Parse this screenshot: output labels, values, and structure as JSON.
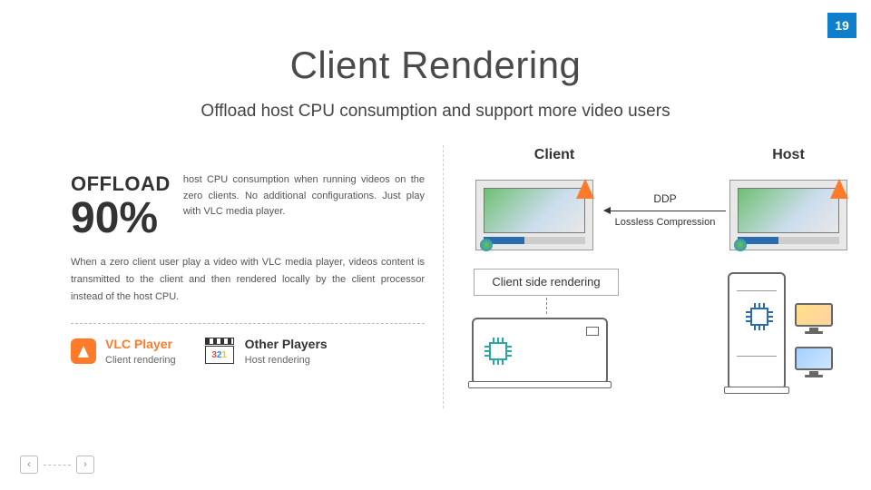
{
  "page_number": "19",
  "title": "Client Rendering",
  "subtitle": "Offload host CPU consumption and support more video users",
  "offload": {
    "label": "OFFLOAD",
    "percent": "90%",
    "desc": "host CPU consumption when running videos on the zero clients. No additional configurations. Just play with VLC media player."
  },
  "paragraph": "When a zero client user play a video with VLC media player, videos content is transmitted to the client and then rendered locally by the client processor instead of the host CPU.",
  "players": {
    "vlc": {
      "title": "VLC Player",
      "sub": "Client rendering"
    },
    "other": {
      "title": "Other Players",
      "sub": "Host rendering",
      "badge": "321"
    }
  },
  "columns": {
    "client": "Client",
    "host": "Host"
  },
  "arrow": {
    "top": "DDP",
    "bottom": "Lossless Compression"
  },
  "csr_label": "Client side rendering",
  "icons": {
    "vlc": "vlc-cone-icon",
    "mpc": "media-player-classic-icon",
    "chip": "cpu-chip-icon",
    "monitor": "monitor-icon"
  },
  "colors": {
    "accent": "#0f7fcc",
    "vlc": "#ff7a29",
    "chip_client": "#2aa8a8",
    "chip_host": "#2b6cb0"
  },
  "nav": {
    "prev": "‹",
    "next": "›"
  }
}
